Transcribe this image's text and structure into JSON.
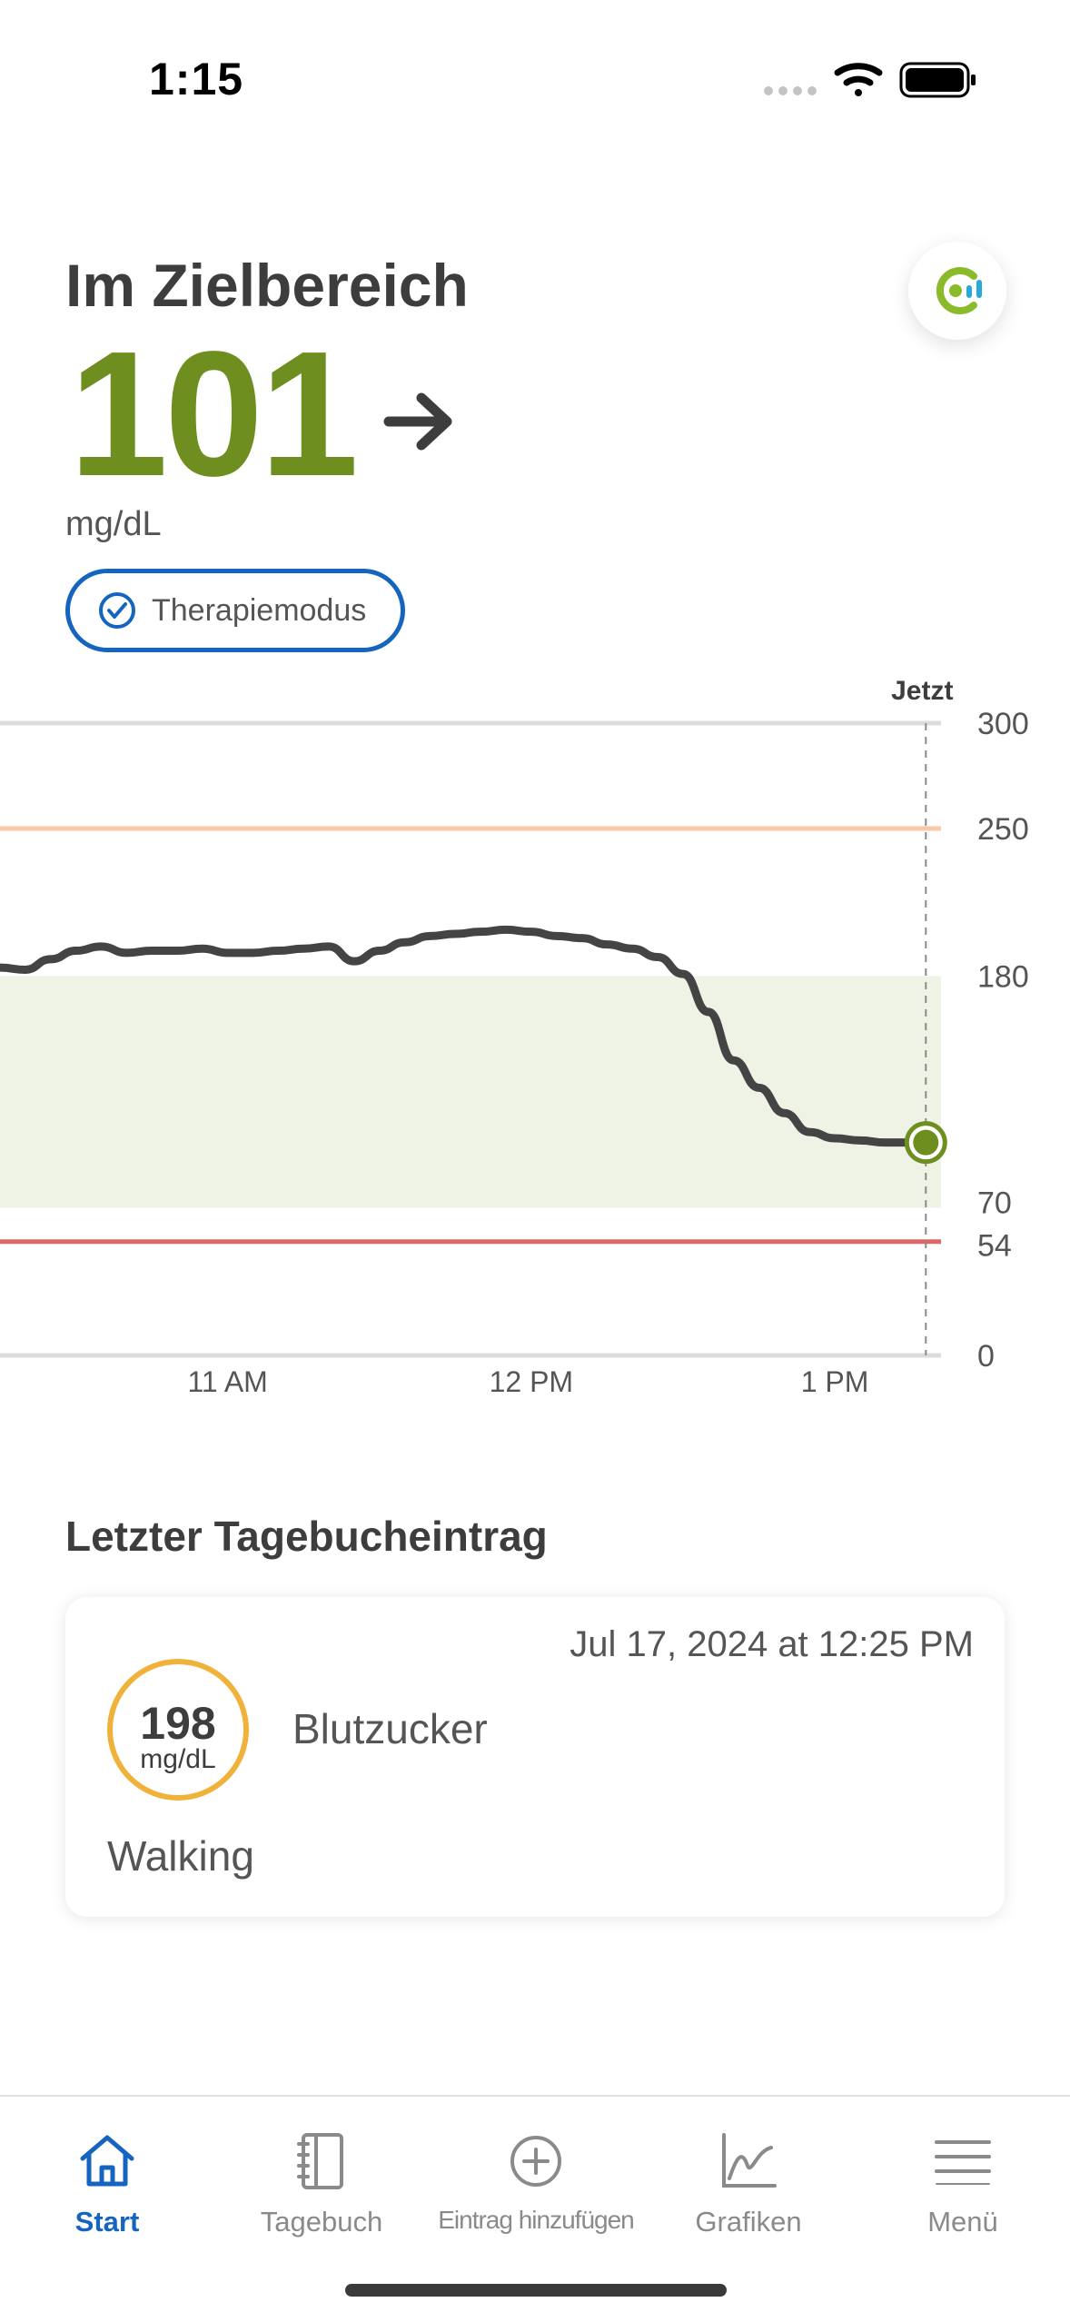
{
  "status_bar": {
    "time": "1:15"
  },
  "header": {
    "title": "Im Zielbereich",
    "value": "101",
    "unit": "mg/dL",
    "trend_icon": "arrow-right-icon",
    "mode_label": "Therapiemodus",
    "logo_icon": "app-logo-icon"
  },
  "colors": {
    "in_range": "#6e8f1f",
    "accent": "#1565c0",
    "high_line": "#f8c9a4",
    "low_line": "#e06666",
    "target_band": "#eef3e6",
    "entry_ring": "#f0b23a"
  },
  "chart_data": {
    "type": "line",
    "now_label": "Jetzt",
    "x_ticks": [
      "11 AM",
      "12 PM",
      "1 PM"
    ],
    "y_ticks": [
      0,
      54,
      70,
      180,
      250,
      300
    ],
    "ylim": [
      0,
      300
    ],
    "target_range": [
      70,
      180
    ],
    "high_threshold": 250,
    "low_threshold": 54,
    "series": [
      {
        "x": [
          "10:15",
          "10:20",
          "10:25",
          "10:30",
          "10:35",
          "10:40",
          "10:45",
          "10:50",
          "10:55",
          "11:00",
          "11:05",
          "11:10",
          "11:15",
          "11:20",
          "11:25",
          "11:30",
          "11:35",
          "11:40",
          "11:45",
          "11:50",
          "11:55",
          "12:00",
          "12:05",
          "12:10",
          "12:15",
          "12:20",
          "12:25",
          "12:30",
          "12:35",
          "12:40",
          "12:45",
          "12:50",
          "12:55",
          "13:00",
          "13:05",
          "13:10",
          "13:15"
        ],
        "y": [
          184,
          183,
          188,
          192,
          194,
          191,
          192,
          192,
          193,
          191,
          191,
          192,
          193,
          194,
          187,
          192,
          196,
          199,
          200,
          201,
          202,
          201,
          199,
          198,
          195,
          193,
          189,
          181,
          163,
          140,
          127,
          115,
          106,
          103,
          102,
          101,
          101
        ]
      }
    ],
    "current": {
      "x": "13:18",
      "y": 101
    }
  },
  "diary": {
    "section_title": "Letzter Tagebucheintrag",
    "entry": {
      "timestamp": "Jul 17, 2024 at 12:25 PM",
      "value": "198",
      "unit": "mg/dL",
      "type": "Blutzucker",
      "note": "Walking"
    }
  },
  "tabbar": {
    "tabs": [
      {
        "label": "Start",
        "icon": "home-icon",
        "active": true
      },
      {
        "label": "Tagebuch",
        "icon": "notebook-icon",
        "active": false
      },
      {
        "label": "Eintrag hinzufügen",
        "icon": "add-circle-icon",
        "active": false
      },
      {
        "label": "Grafiken",
        "icon": "chart-icon",
        "active": false
      },
      {
        "label": "Menü",
        "icon": "menu-icon",
        "active": false
      }
    ]
  }
}
